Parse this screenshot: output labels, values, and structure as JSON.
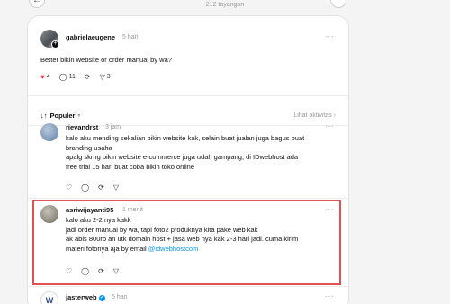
{
  "header": {
    "views": "212 tayangan",
    "back_icon": "arrow-left-icon",
    "more_icon": "more-icon"
  },
  "main_post": {
    "username": "gabrielaeugene",
    "time": "5 hari",
    "text": "Better bikin website or order manual by wa?",
    "likes": "4",
    "replies": "11",
    "shares": "3",
    "more": "···"
  },
  "sort": {
    "label": "Populer",
    "activity": "Lihat aktivitas ›"
  },
  "replies": [
    {
      "username": "rievandrst",
      "time": "3 jam",
      "lines": [
        "kalo aku mending sekalian bikin website kak, selain buat jualan juga bagus buat",
        "branding usaha",
        "apalg skrng bikin website e-commerce juga udah gampang, di IDwebhost ada",
        "free trial 15 hari buat coba bikin toko online"
      ],
      "more": "···"
    },
    {
      "username": "asriwijayanti95",
      "time": "1 menit",
      "lines": [
        "kalo aku 2-2 nya kakk",
        "jadi order manual by wa, tapi foto2 produknya kita pake web kak",
        "ak abis 800rb an utk domain host + jasa web nya kak 2-3 hari jadi. cuma kirim",
        "materi fotonya aja by email "
      ],
      "mention": "@idwebhostcom",
      "more": "···"
    },
    {
      "username": "jasterweb",
      "time": "5 hari",
      "more": "···"
    }
  ],
  "colors": {
    "accent": "#0095f6",
    "like": "#ff3040",
    "highlight": "#e05252"
  }
}
